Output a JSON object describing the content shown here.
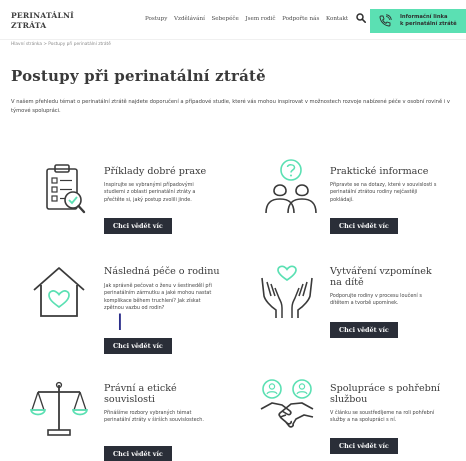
{
  "header": {
    "logo_line1": "PERINATÁLNÍ",
    "logo_line2": "ZTRÁTA",
    "nav": [
      "Postupy",
      "Vzdělávání",
      "Sebepéče",
      "Jsem rodič",
      "Podpořte nás",
      "Kontakt"
    ],
    "hotline_line1": "Informační linka",
    "hotline_line2": "k perinatální ztrátě"
  },
  "breadcrumb": "Hlavní stránka > Postupy při perinatální ztrátě",
  "page_title": "Postupy při perinatální ztrátě",
  "intro": "V našem přehledu témat o perinatální ztrátě najdete doporučení a případové studie, které vás mohou inspirovat v možnostech rozvoje nabízené péče v osobní rovině i v týmové spolupráci.",
  "cards": [
    {
      "title": "Příklady dobré praxe",
      "description": "Inspirujte se vybranými případovými studiemi z oblasti perinatální ztráty a přečtěte si, jaký postup zvolili jinde.",
      "button": "Chci vědět víc",
      "icon": "checklist-icon"
    },
    {
      "title": "Praktické informace",
      "description": "Připravte se na dotazy, které v souvislosti s perinatální ztrátou rodiny nejčastěji pokládají.",
      "button": "Chci vědět víc",
      "icon": "question-people-icon"
    },
    {
      "title": "Následná péče o rodinu",
      "description": "Jak správně pečovat o ženu v šestinedělí při perinatálním zármutku a jaké mohou nastat komplikace během truchlení? Jak získat zpětnou vazbu od rodin?",
      "button": "Chci vědět víc",
      "icon": "house-heart-icon"
    },
    {
      "title_line1": "Vytváření vzpomínek",
      "title_line2": "na dítě",
      "description": "Podporujte rodiny v procesu loučení s dítětem a tvorbě upomínek.",
      "button": "Chci vědět víc",
      "icon": "hands-heart-icon"
    },
    {
      "title_line1": "Právní a etické",
      "title_line2": "souvislosti",
      "description": "Přinášíme rozbory vybraných témat perinatální ztráty v širších souvislostech.",
      "button": "Chci vědět víc",
      "icon": "scales-icon"
    },
    {
      "title_line1": "Spolupráce s pohřební",
      "title_line2": "službou",
      "description": "V článku se soustředíjeme na roli pohřební služby a na spolupráci s ní.",
      "button": "Chci vědět víc",
      "icon": "handshake-icon"
    }
  ],
  "edge_glyph": "l",
  "colors": {
    "accent": "#5be0b3",
    "button_bg": "#2a2e38",
    "icon_stroke": "#3a3a3a",
    "icon_accent": "#5be0b3"
  }
}
